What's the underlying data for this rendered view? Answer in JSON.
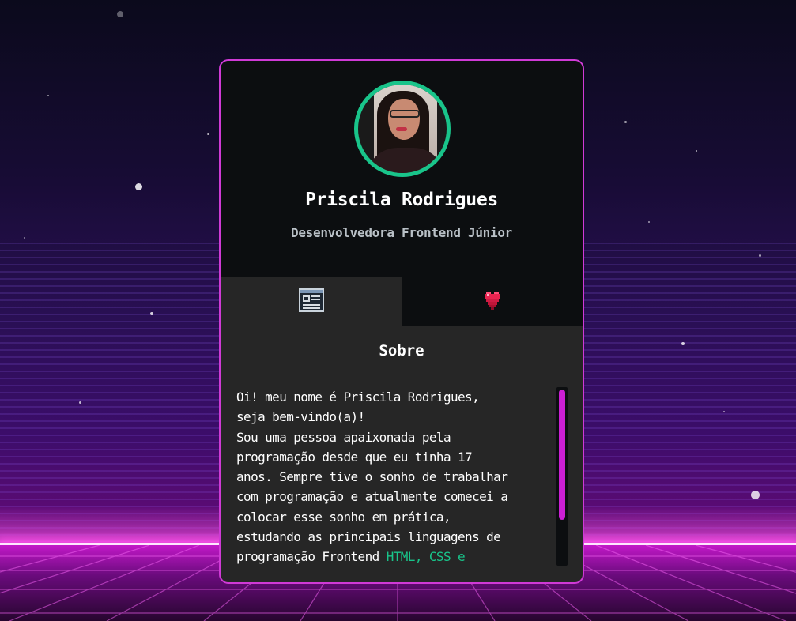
{
  "profile": {
    "name": "Priscila Rodrigues",
    "role": "Desenvolvedora Frontend Júnior"
  },
  "tabs": [
    {
      "icon": "profile-card-icon",
      "active": true
    },
    {
      "icon": "heart-icon",
      "active": false
    }
  ],
  "about": {
    "title": "Sobre",
    "text": "Oi! meu nome é Priscila Rodrigues,\nseja bem-vindo(a)!\nSou uma pessoa apaixonada pela\nprogramação desde que eu tinha 17\nanos. Sempre tive o sonho de trabalhar\ncom programação e atualmente comecei a\ncolocar esse sonho em prática,\nestudando as principais linguagens de\nprogramação Frontend ",
    "highlight": "HTML, CSS e"
  },
  "colors": {
    "accent_green": "#19c48a",
    "accent_magenta": "#cc1fd4",
    "card_border": "#d03ad6"
  }
}
